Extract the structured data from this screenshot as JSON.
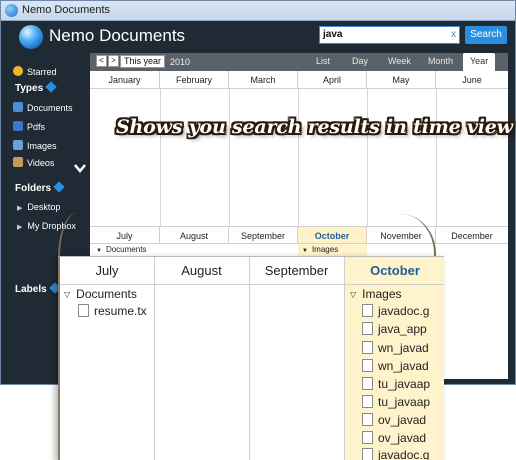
{
  "window": {
    "title": "Nemo Documents"
  },
  "header": {
    "brand": "Nemo Documents",
    "search_value": "java",
    "search_button": "Search",
    "clear_icon": "x"
  },
  "sidebar": {
    "starred": "Starred",
    "types_heading": "Types",
    "types": [
      "Documents",
      "Pdfs",
      "Images",
      "Videos"
    ],
    "folders_heading": "Folders",
    "folders": [
      "Desktop",
      "My Dropbox"
    ],
    "labels_heading": "Labels"
  },
  "calendar": {
    "prev": "<",
    "next": ">",
    "this_year": "This year",
    "year": "2010",
    "views": [
      "List",
      "Day",
      "Week",
      "Month",
      "Year"
    ],
    "active_view": "Year",
    "months_top": [
      "January",
      "February",
      "March",
      "April",
      "May",
      "June"
    ],
    "months_bottom": [
      "July",
      "August",
      "September",
      "October",
      "November",
      "December"
    ],
    "highlight_month": "October",
    "sub_documents": "Documents",
    "sub_images": "Images"
  },
  "caption": "Shows you search results in time view",
  "zoom": {
    "months": [
      "July",
      "August",
      "September",
      "October"
    ],
    "documents_label": "Documents",
    "documents_files": [
      "resume.tx"
    ],
    "images_label": "Images",
    "image_files": [
      "javadoc.g",
      "java_app",
      "wn_javad",
      "wn_javad",
      "tu_javaap",
      "tu_javaap",
      "ov_javad",
      "ov_javad",
      "javadoc.g"
    ]
  },
  "colors": {
    "accent": "#2a8ee0",
    "dark_bg": "#1f2a35",
    "highlight": "#fff3cc",
    "month_highlight_text": "#1f5f99"
  }
}
